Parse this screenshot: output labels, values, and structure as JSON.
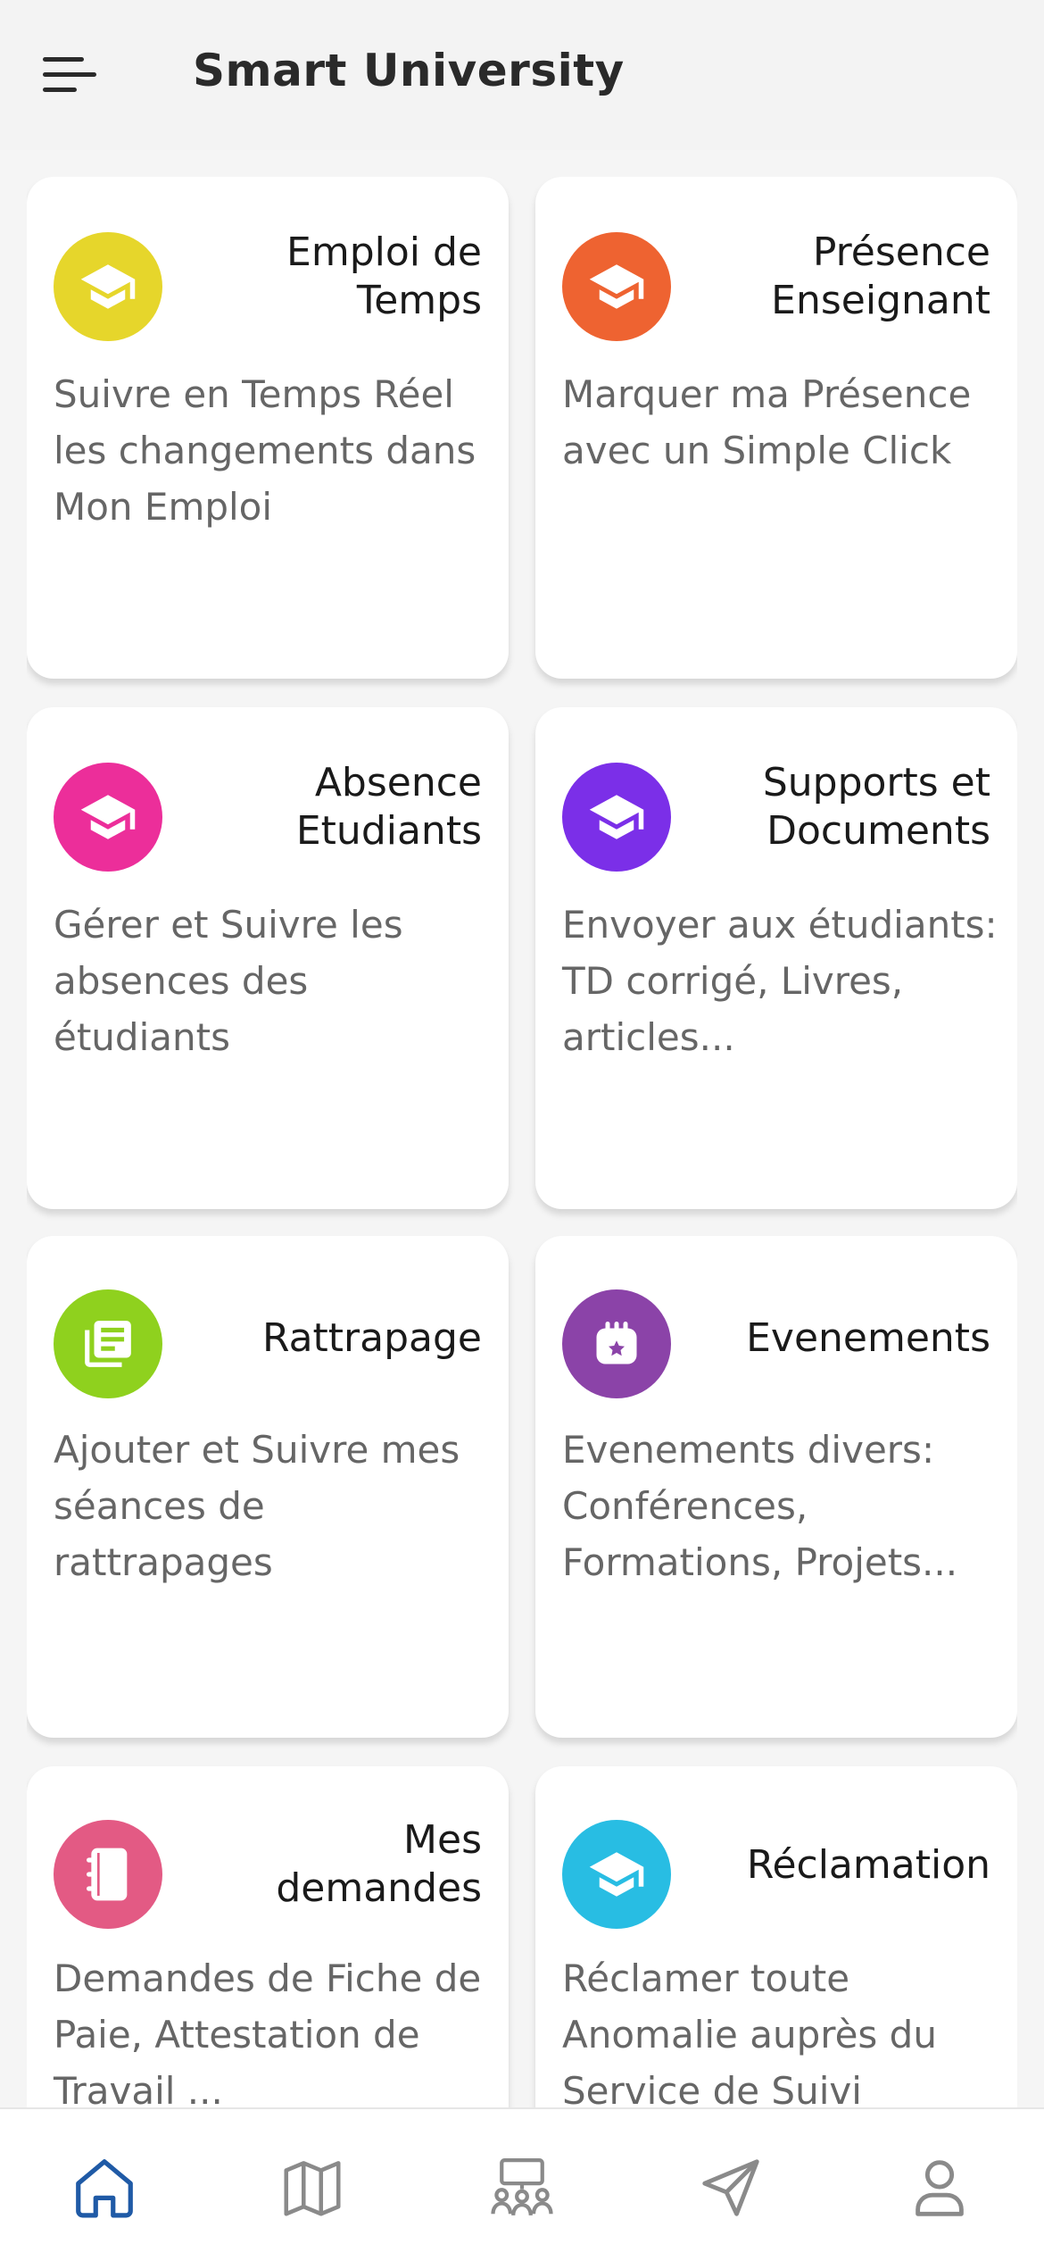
{
  "header": {
    "title": "Smart University",
    "menu_icon": "menu-icon"
  },
  "cards": [
    {
      "title": "Emploi de Temps",
      "description": "Suivre en Temps Réel les changements dans Mon Emploi",
      "icon": "graduation-cap-icon",
      "color": "#e6d62b"
    },
    {
      "title": "Présence Enseignant",
      "description": "Marquer ma Présence avec un Simple Click",
      "icon": "graduation-cap-icon",
      "color": "#ee6331"
    },
    {
      "title": "Absence Etudiants",
      "description": "Gérer et Suivre les absences des étudiants",
      "icon": "graduation-cap-icon",
      "color": "#ec2e9a"
    },
    {
      "title": "Supports et Documents",
      "description": "Envoyer aux étudiants: TD corrigé, Livres, articles...",
      "icon": "graduation-cap-icon",
      "color": "#7b2fe8"
    },
    {
      "title": "Rattrapage",
      "description": "Ajouter et Suivre mes séances de rattrapages",
      "icon": "library-books-icon",
      "color": "#8fd11e"
    },
    {
      "title": "Evenements",
      "description": "Evenements divers: Conférences, Formations, Projets...",
      "icon": "event-calendar-icon",
      "color": "#8b43a8"
    },
    {
      "title": "Mes demandes",
      "description": "Demandes de Fiche de Paie, Attestation de Travail ...",
      "icon": "notebook-icon",
      "color": "#e35a84"
    },
    {
      "title": "Réclamation",
      "description": "Réclamer toute Anomalie auprès du Service de Suivi",
      "icon": "graduation-cap-icon",
      "color": "#28bde3"
    }
  ],
  "bottom_nav": [
    {
      "icon": "home-icon",
      "active": true
    },
    {
      "icon": "map-icon",
      "active": false
    },
    {
      "icon": "people-board-icon",
      "active": false
    },
    {
      "icon": "send-icon",
      "active": false
    },
    {
      "icon": "profile-icon",
      "active": false
    }
  ],
  "colors": {
    "active_nav": "#1f5aa6",
    "inactive_nav": "#8a8a8a"
  }
}
